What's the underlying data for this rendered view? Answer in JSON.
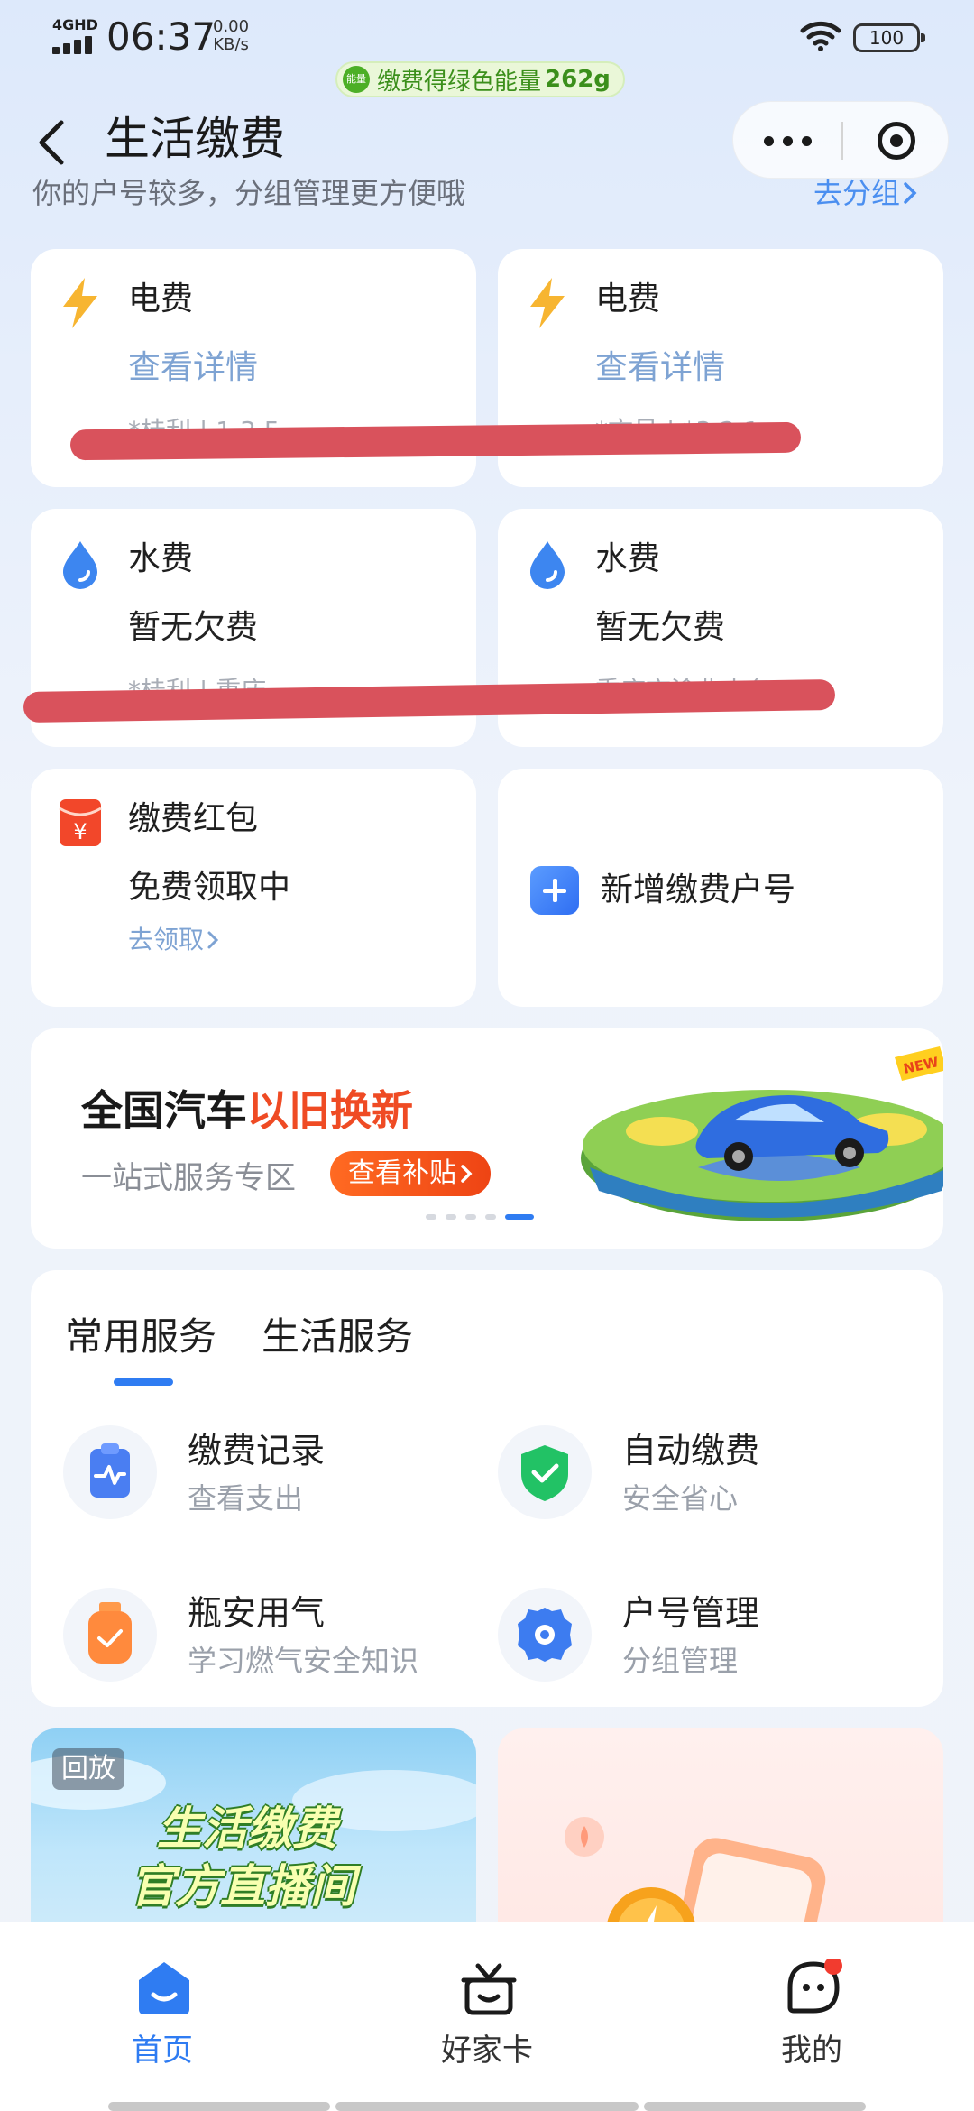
{
  "status_bar": {
    "network": "4GHD",
    "time": "06:37",
    "speed_value": "0.00",
    "speed_unit": "KB/s",
    "battery": "100"
  },
  "energy_banner": {
    "badge": "能量",
    "text": "缴费得绿色能量",
    "value": "262g"
  },
  "header": {
    "title": "生活缴费",
    "subtitle": "你的户号较多，分组管理更方便哦",
    "group_link": "去分组",
    "more_icon": "more-dots-icon",
    "close_icon": "miniprogram-close-icon"
  },
  "accounts": [
    {
      "icon": "lightning-icon",
      "title": "电费",
      "line2": "查看详情",
      "line3": "*桂利 | 1·3·5"
    },
    {
      "icon": "lightning-icon",
      "title": "电费",
      "line2": "查看详情",
      "line3": "*文员 | *3·2·1"
    },
    {
      "icon": "water-drop-icon",
      "title": "水费",
      "line2": "暂无欠费",
      "line3": "*桂利 | 重庆"
    },
    {
      "icon": "water-drop-icon",
      "title": "水费",
      "line2": "暂无欠费",
      "line3": "重庆市渝北水务…"
    }
  ],
  "red_packet": {
    "icon": "red-packet-icon",
    "title": "缴费红包",
    "line2": "免费领取中",
    "link": "去领取"
  },
  "add_account": {
    "icon": "plus-icon",
    "label": "新增缴费户号"
  },
  "banner": {
    "title_prefix": "全国汽车",
    "title_highlight": "以旧换新",
    "subtitle": "一站式服务专区",
    "button": "查看补贴",
    "badge": "NEW",
    "highlight_color": "#ef4b24",
    "slides": 5,
    "active_slide": 5
  },
  "services": {
    "tabs": [
      "常用服务",
      "生活服务"
    ],
    "active_tab": 0,
    "items": [
      {
        "icon": "bill-record-icon",
        "title": "缴费记录",
        "subtitle": "查看支出"
      },
      {
        "icon": "shield-check-icon",
        "title": "自动缴费",
        "subtitle": "安全省心"
      },
      {
        "icon": "gas-tank-icon",
        "title": "瓶安用气",
        "subtitle": "学习燃气安全知识"
      },
      {
        "icon": "gear-icon",
        "title": "户号管理",
        "subtitle": "分组管理"
      }
    ]
  },
  "promos": {
    "left_tag": "回放",
    "left_line1": "生活缴费",
    "left_line2": "官方直播间"
  },
  "tabbar": {
    "items": [
      {
        "icon": "home-icon",
        "label": "首页",
        "active": true
      },
      {
        "icon": "gift-box-icon",
        "label": "好家卡",
        "active": false
      },
      {
        "icon": "profile-icon",
        "label": "我的",
        "active": false
      }
    ],
    "accent": "#2f7cf2"
  }
}
